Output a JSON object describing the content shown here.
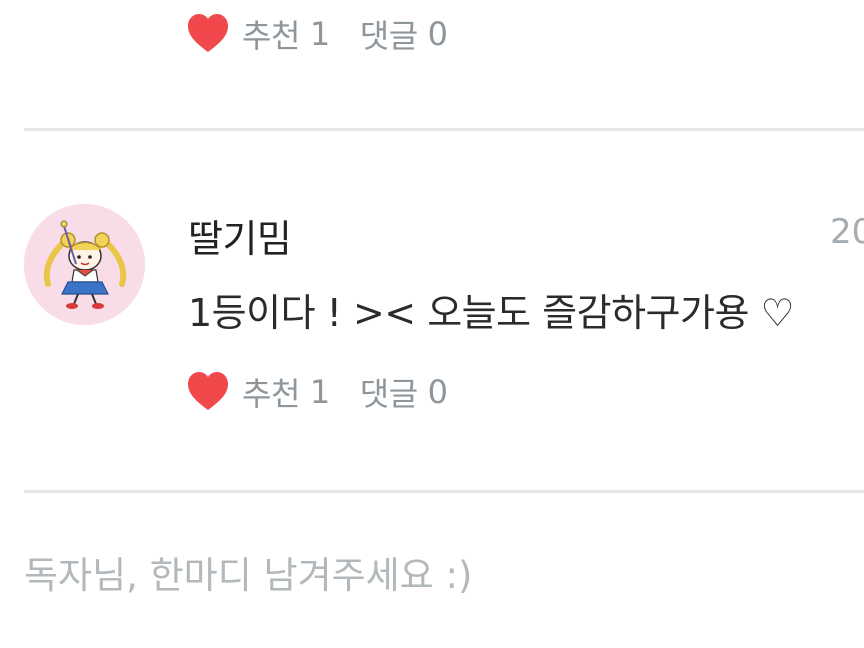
{
  "top_comment": {
    "like_label": "추천",
    "like_count": "1",
    "reply_label": "댓글",
    "reply_count": "0"
  },
  "comment": {
    "author": "딸기밈",
    "date": "20",
    "text": "1등이다 ! >< 오늘도 즐감하구가용 ♡",
    "avatar_icon": "sailor-moon-character-avatar",
    "like_label": "추천",
    "like_count": "1",
    "reply_label": "댓글",
    "reply_count": "0"
  },
  "reply_box": {
    "placeholder": "독자님, 한마디 남겨주세요 :)"
  },
  "colors": {
    "heart": "#f0484b",
    "meta_text": "#8e969b",
    "divider": "#e4e7e8",
    "placeholder": "#b2b8bb",
    "avatar_bg": "#f8dde9"
  }
}
